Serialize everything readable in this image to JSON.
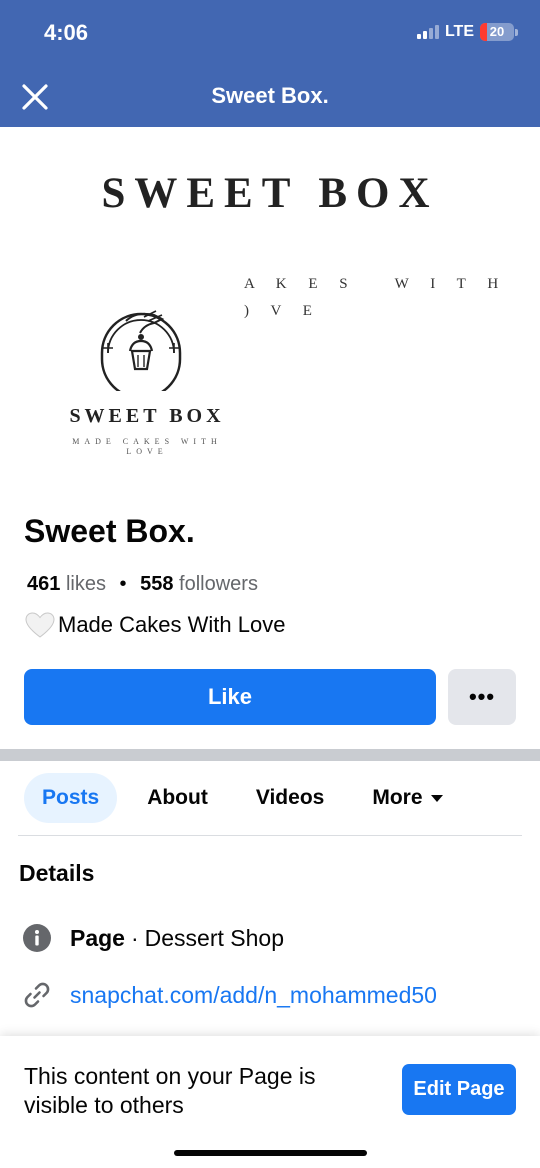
{
  "status_bar": {
    "time": "4:06",
    "network": "LTE",
    "battery": "20",
    "battery_level": 0.2,
    "battery_color": "#ff3b30"
  },
  "nav": {
    "title": "Sweet Box.",
    "close_icon": "close-icon"
  },
  "cover": {
    "headline": "SWEET BOX",
    "tagline": "A K E S   W I T H\n) V E",
    "logo_name": "SWEET BOX",
    "logo_sub": "MADE CAKES WITH\nLOVE"
  },
  "profile": {
    "name": "Sweet Box.",
    "likes_count": "461",
    "likes_label": "likes",
    "followers_count": "558",
    "followers_label": "followers",
    "bio": "Made Cakes With Love"
  },
  "actions": {
    "like_label": "Like",
    "more_label": "•••"
  },
  "tabs": [
    {
      "label": "Posts",
      "active": true
    },
    {
      "label": "About"
    },
    {
      "label": "Videos"
    },
    {
      "label": "More"
    }
  ],
  "details": {
    "title": "Details",
    "category_label": "Page",
    "category_value": "Dessert Shop",
    "link": "snapchat.com/add/n_mohammed50"
  },
  "footer": {
    "text": "This content on your Page is visible to others",
    "edit_label": "Edit Page"
  },
  "colors": {
    "header": "#4267b2",
    "accent": "#1877f2",
    "tab_active_bg": "#e7f3ff"
  }
}
